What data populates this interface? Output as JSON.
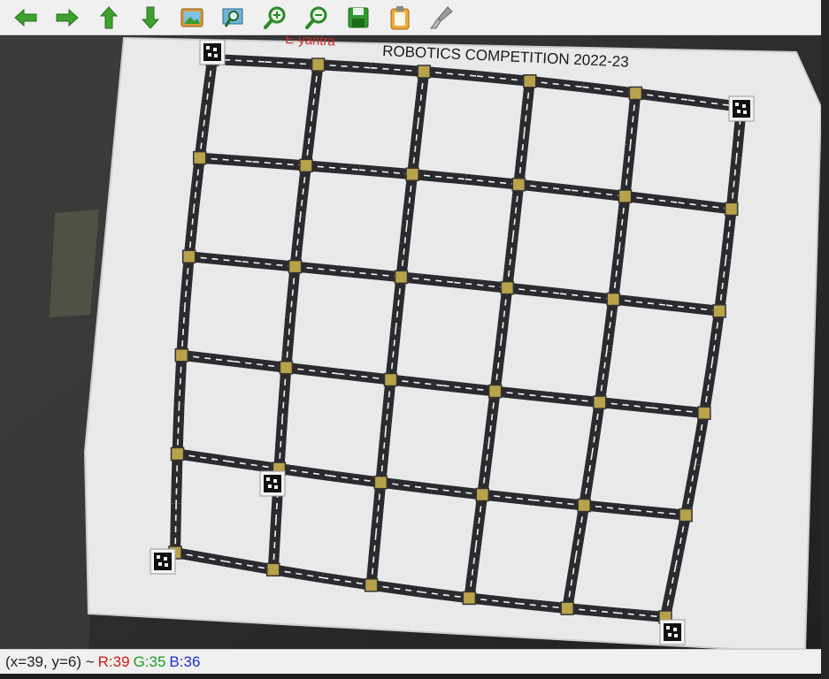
{
  "toolbar": {
    "buttons": [
      {
        "id": "back",
        "icon": "arrow-left-icon",
        "color": "#3a9a2a"
      },
      {
        "id": "forward",
        "icon": "arrow-right-icon",
        "color": "#3a9a2a"
      },
      {
        "id": "up",
        "icon": "arrow-up-icon",
        "color": "#3a9a2a"
      },
      {
        "id": "down",
        "icon": "arrow-down-icon",
        "color": "#3a9a2a"
      },
      {
        "id": "image",
        "icon": "image-icon",
        "color": "#c08a2a"
      },
      {
        "id": "zoom-region",
        "icon": "zoom-region-icon",
        "color": "#2a7a9a"
      },
      {
        "id": "zoom-in",
        "icon": "zoom-in-icon",
        "color": "#2a8a2a"
      },
      {
        "id": "zoom-out",
        "icon": "zoom-out-icon",
        "color": "#2a8a2a"
      },
      {
        "id": "save",
        "icon": "save-icon",
        "color": "#2a8a2a"
      },
      {
        "id": "copy",
        "icon": "clipboard-icon",
        "color": "#e08a20"
      },
      {
        "id": "properties",
        "icon": "brush-icon",
        "color": "#8a8a8a"
      }
    ]
  },
  "image": {
    "banner_text": "ROBOTICS COMPETITION 2022-23",
    "banner_logo": "E-yantra",
    "grid_columns": 6,
    "grid_rows": 6,
    "colors": {
      "mat": "#e9e9e9",
      "road": "#2a2a2f",
      "node": "#b8a24a",
      "lane": "#f2f2f2"
    }
  },
  "status": {
    "coords": "(x=39, y=6) ~",
    "r": "R:39",
    "g": "G:35",
    "b": "B:36"
  }
}
